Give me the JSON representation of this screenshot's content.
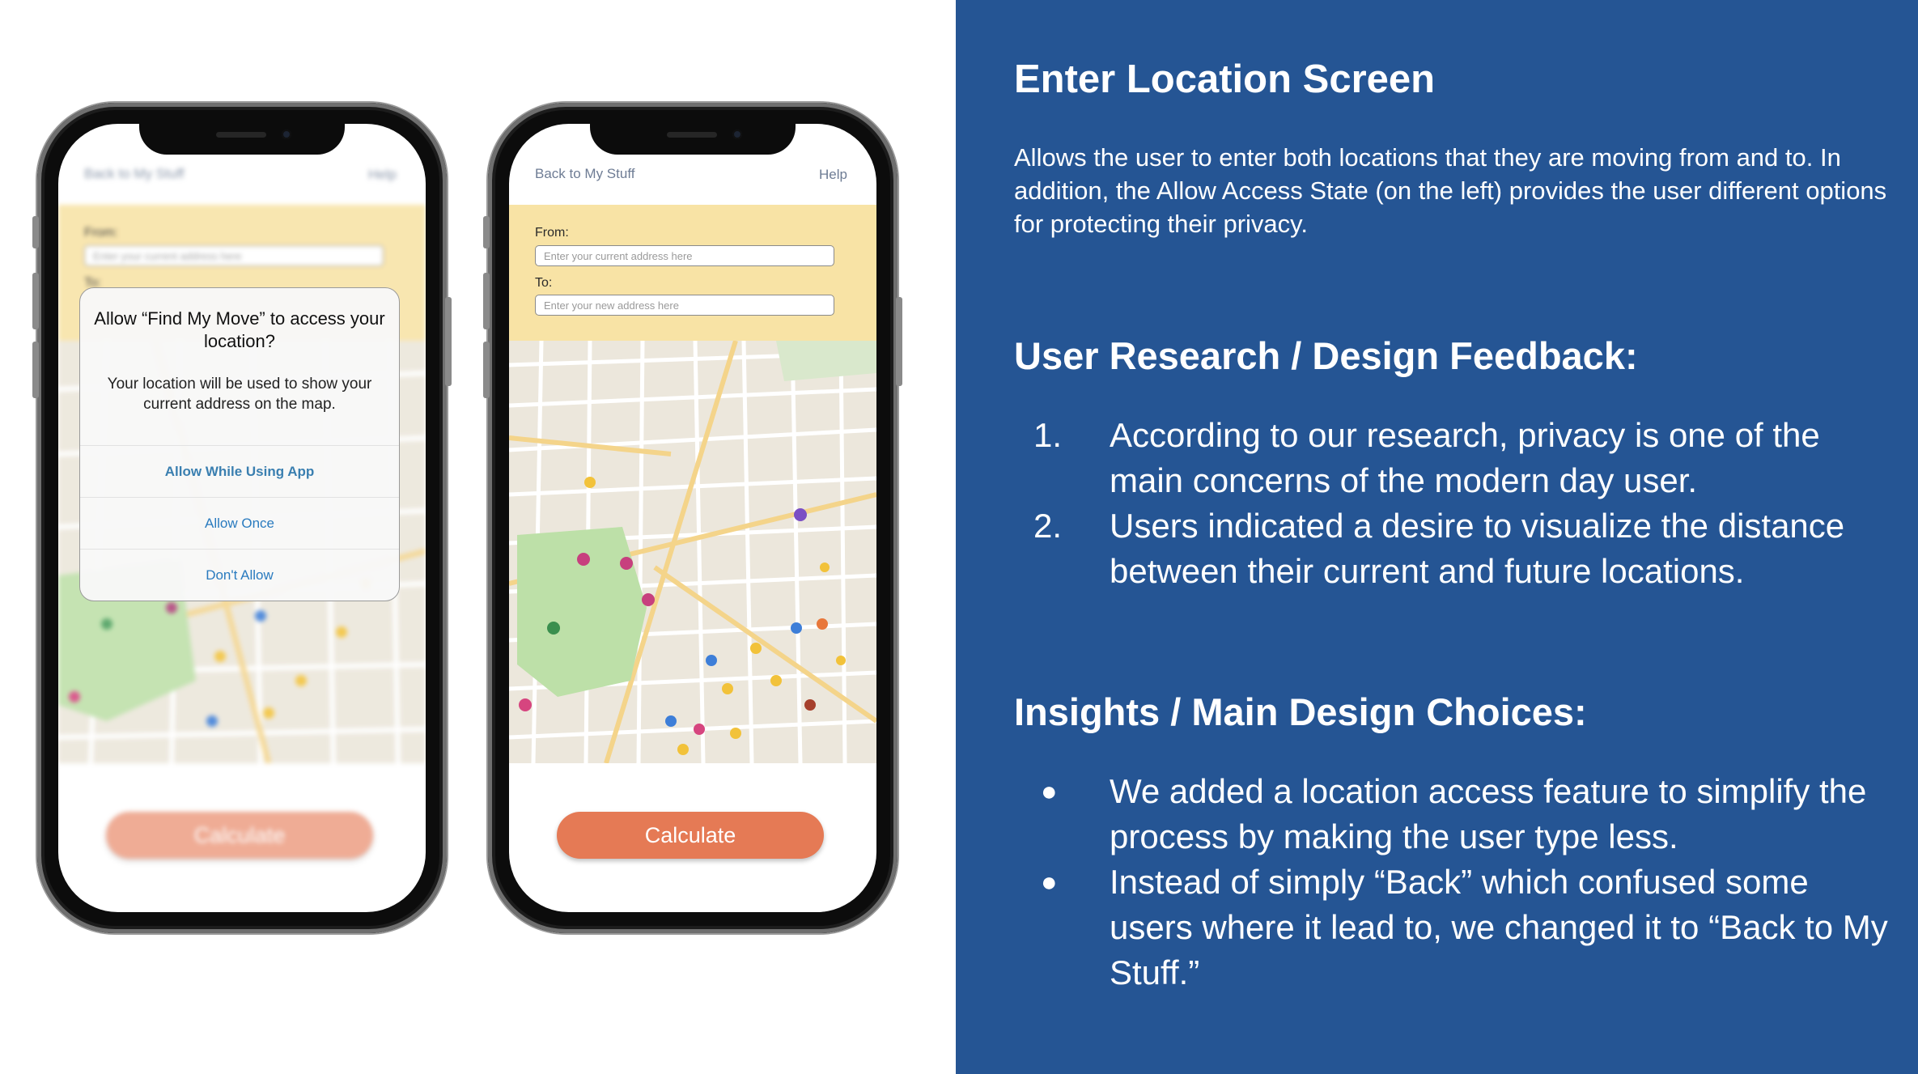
{
  "left_phone": {
    "back_label": "Back to My Stuff",
    "help_label": "Help",
    "from_label": "From:",
    "from_placeholder": "Enter your current address here",
    "to_label": "To:",
    "calculate_label": "Calculate",
    "alert": {
      "title": "Allow “Find My Move” to access your location?",
      "message": "Your location will be used to show your current address on the map.",
      "options": [
        "Allow While Using App",
        "Allow Once",
        "Don't Allow"
      ]
    }
  },
  "right_phone": {
    "back_label": "Back to My Stuff",
    "help_label": "Help",
    "from_label": "From:",
    "from_placeholder": "Enter your current address here",
    "to_label": "To:",
    "to_placeholder": "Enter your new address here",
    "calculate_label": "Calculate"
  },
  "panel": {
    "title": "Enter Location Screen",
    "description": "Allows the user to enter both locations that they are moving from and to. In addition, the Allow Access State (on the left) provides the user different options for protecting their privacy.",
    "research_heading": "User Research / Design Feedback:",
    "research_items": [
      {
        "marker": "1.",
        "text": "According to our research, privacy is one of the main concerns of the modern day user."
      },
      {
        "marker": "2.",
        "text": "Users indicated a desire to visualize the distance between their current and future locations."
      }
    ],
    "insights_heading": "Insights / Main Design Choices:",
    "insights_items": [
      {
        "marker": "●",
        "text": "We added a location access feature to simplify the process by making the user type less."
      },
      {
        "marker": "●",
        "text": "Instead of simply “Back” which confused some users where it lead to, we changed it to “Back to My Stuff.”"
      }
    ]
  },
  "colors": {
    "panel_bg": "#255594",
    "form_bg": "#f8e3a5",
    "calculate_bg": "#e57a55",
    "park_green": "#bde0a8"
  }
}
